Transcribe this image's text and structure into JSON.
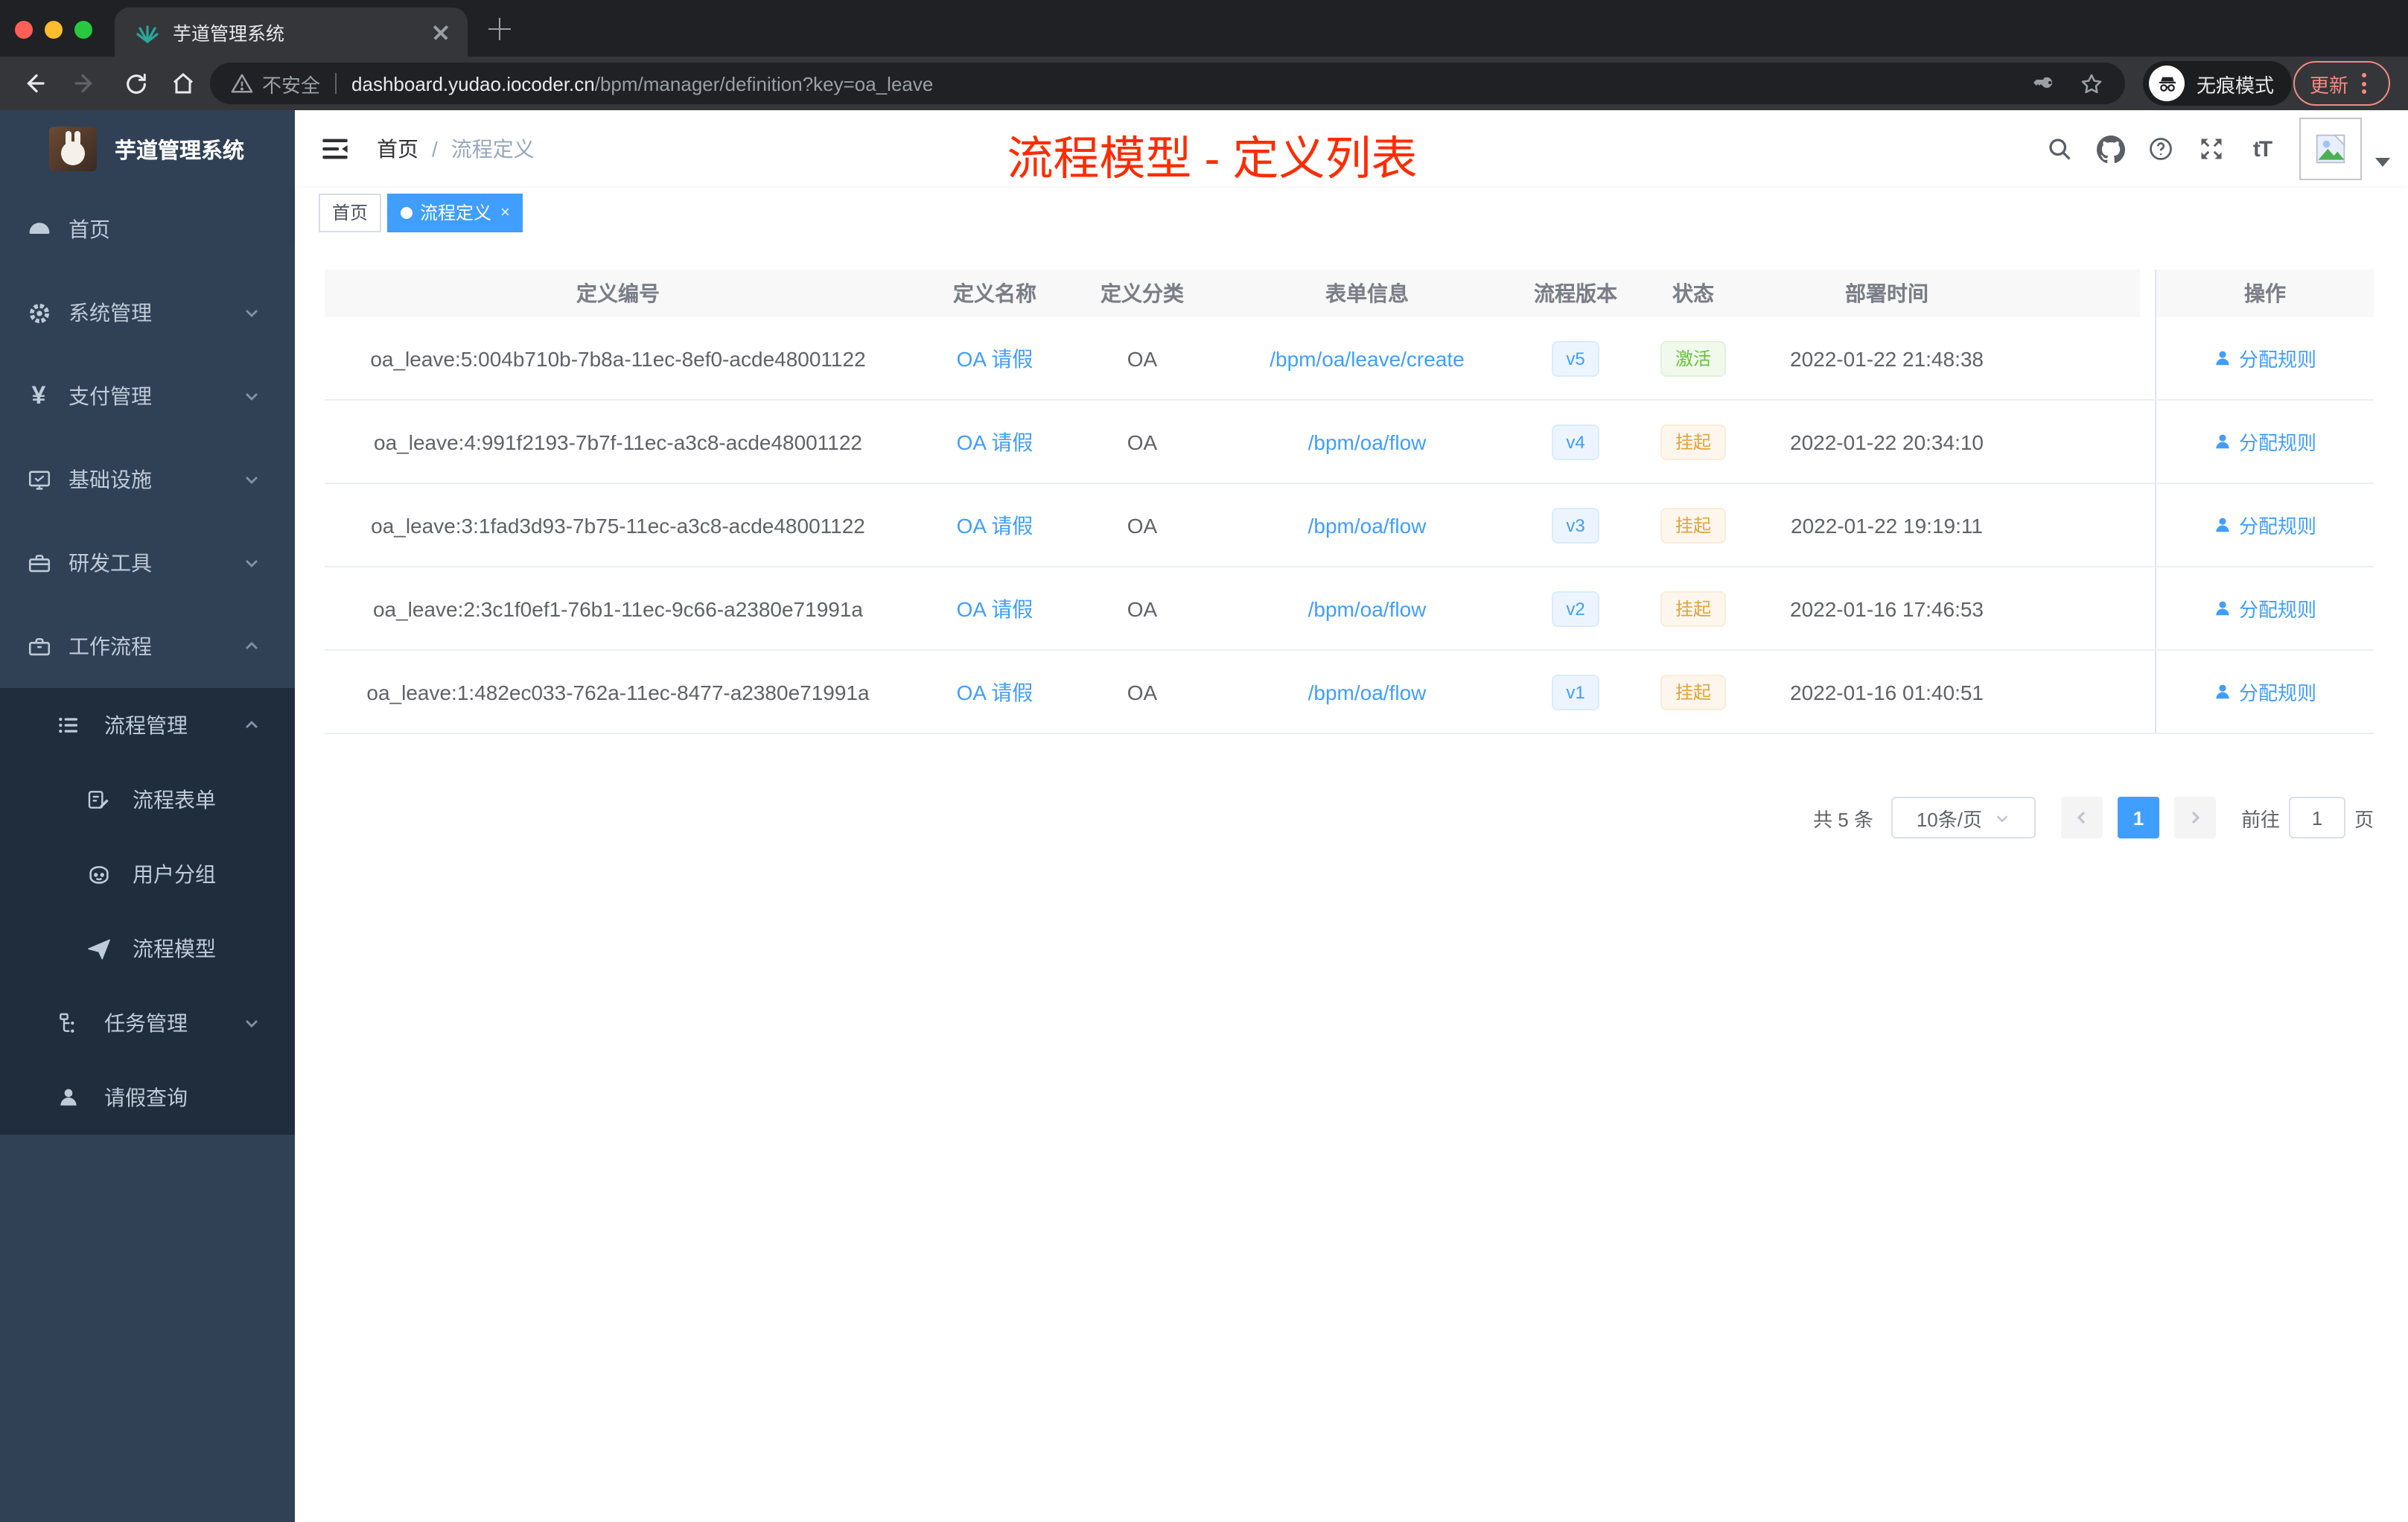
{
  "browser": {
    "tab_title": "芋道管理系统",
    "security": "不安全",
    "url_host": "dashboard.yudao.iocoder.cn",
    "url_path": "/bpm/manager/definition?key=oa_leave",
    "incognito": "无痕模式",
    "update": "更新"
  },
  "sidebar": {
    "title": "芋道管理系统",
    "items": [
      {
        "label": "首页",
        "icon": "dashboard-icon"
      },
      {
        "label": "系统管理",
        "icon": "gear-icon",
        "icon_text": "",
        "expand": "down"
      },
      {
        "label": "支付管理",
        "icon": "yen-icon",
        "icon_text": "¥",
        "expand": "down"
      },
      {
        "label": "基础设施",
        "icon": "monitor-icon",
        "expand": "down"
      },
      {
        "label": "研发工具",
        "icon": "toolbox-icon",
        "expand": "down"
      },
      {
        "label": "工作流程",
        "icon": "briefcase-icon",
        "expand": "up"
      }
    ],
    "children": [
      {
        "label": "流程管理",
        "icon": "tree-list-icon",
        "expand": "up"
      },
      {
        "label": "流程表单",
        "icon": "form-edit-icon"
      },
      {
        "label": "用户分组",
        "icon": "robot-icon"
      },
      {
        "label": "流程模型",
        "icon": "paper-plane-icon"
      },
      {
        "label": "任务管理",
        "icon": "org-tree-icon",
        "expand": "down"
      },
      {
        "label": "请假查询",
        "icon": "user-icon"
      }
    ]
  },
  "header": {
    "breadcrumb_home": "首页",
    "breadcrumb_separator": "/",
    "breadcrumb_current": "流程定义",
    "annotation": "流程模型 - 定义列表",
    "fontsize_icon_text": "tT"
  },
  "tags": {
    "home": "首页",
    "active": "流程定义"
  },
  "table": {
    "columns": [
      "定义编号",
      "定义名称",
      "定义分类",
      "表单信息",
      "流程版本",
      "状态",
      "部署时间",
      "操作"
    ],
    "rows": [
      {
        "id": "oa_leave:5:004b710b-7b8a-11ec-8ef0-acde48001122",
        "name": "OA 请假",
        "category": "OA",
        "form": "/bpm/oa/leave/create",
        "version": "v5",
        "status": "激活",
        "status_type": "success",
        "deploy_time": "2022-01-22 21:48:38",
        "action": "分配规则"
      },
      {
        "id": "oa_leave:4:991f2193-7b7f-11ec-a3c8-acde48001122",
        "name": "OA 请假",
        "category": "OA",
        "form": "/bpm/oa/flow",
        "version": "v4",
        "status": "挂起",
        "status_type": "warning",
        "deploy_time": "2022-01-22 20:34:10",
        "action": "分配规则"
      },
      {
        "id": "oa_leave:3:1fad3d93-7b75-11ec-a3c8-acde48001122",
        "name": "OA 请假",
        "category": "OA",
        "form": "/bpm/oa/flow",
        "version": "v3",
        "status": "挂起",
        "status_type": "warning",
        "deploy_time": "2022-01-22 19:19:11",
        "action": "分配规则"
      },
      {
        "id": "oa_leave:2:3c1f0ef1-76b1-11ec-9c66-a2380e71991a",
        "name": "OA 请假",
        "category": "OA",
        "form": "/bpm/oa/flow",
        "version": "v2",
        "status": "挂起",
        "status_type": "warning",
        "deploy_time": "2022-01-16 17:46:53",
        "action": "分配规则"
      },
      {
        "id": "oa_leave:1:482ec033-762a-11ec-8477-a2380e71991a",
        "name": "OA 请假",
        "category": "OA",
        "form": "/bpm/oa/flow",
        "version": "v1",
        "status": "挂起",
        "status_type": "warning",
        "deploy_time": "2022-01-16 01:40:51",
        "action": "分配规则"
      }
    ]
  },
  "pagination": {
    "total": "共 5 条",
    "size": "10条/页",
    "page": "1",
    "goto": "前往",
    "input": "1",
    "unit": "页"
  },
  "colors": {
    "accent": "#409eff",
    "success": "#67c23a",
    "warning": "#e6a23c",
    "annotation_red": "#fe2c00",
    "sidebar_bg": "#304156",
    "submenu_bg": "#1f2d3d",
    "chrome_dark": "#202124",
    "chrome_toolbar": "#35363a"
  }
}
